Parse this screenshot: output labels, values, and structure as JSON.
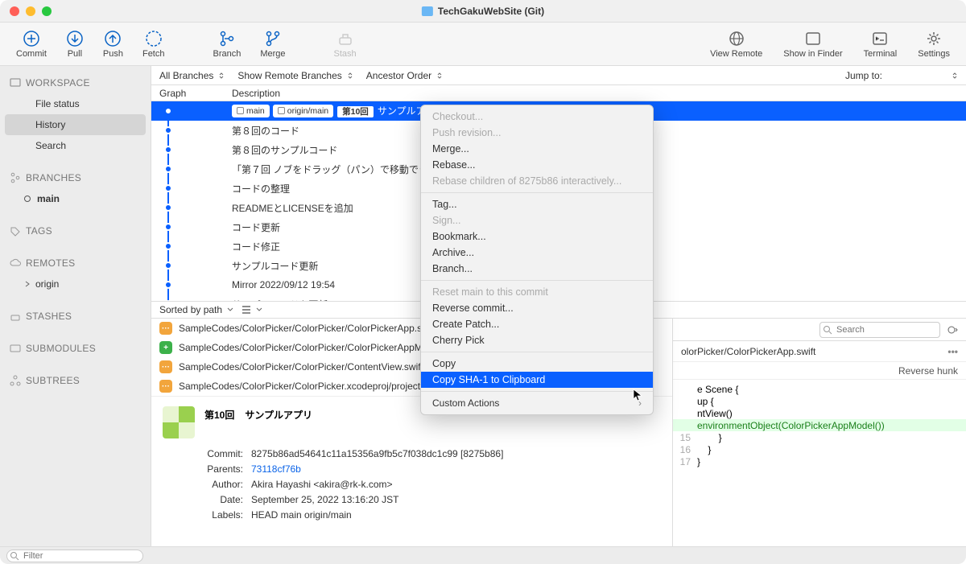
{
  "title": "TechGakuWebSite (Git)",
  "toolbar": {
    "commit": "Commit",
    "pull": "Pull",
    "push": "Push",
    "fetch": "Fetch",
    "branch": "Branch",
    "merge": "Merge",
    "stash": "Stash",
    "view_remote": "View Remote",
    "show_in_finder": "Show in Finder",
    "terminal": "Terminal",
    "settings": "Settings"
  },
  "sidebar": {
    "workspace_hdr": "WORKSPACE",
    "file_status": "File status",
    "history": "History",
    "search": "Search",
    "branches_hdr": "BRANCHES",
    "main_branch": "main",
    "tags_hdr": "TAGS",
    "remotes_hdr": "REMOTES",
    "origin": "origin",
    "stashes_hdr": "STASHES",
    "submodules_hdr": "SUBMODULES",
    "subtrees_hdr": "SUBTREES"
  },
  "filterbar": {
    "all_branches": "All Branches",
    "show_remote": "Show Remote Branches",
    "ancestor": "Ancestor Order",
    "jump": "Jump to:"
  },
  "cols": {
    "graph": "Graph",
    "desc": "Description"
  },
  "commits": [
    {
      "badges": [
        "main",
        "origin/main"
      ],
      "episode": "第10回",
      "text": "サンプルア"
    },
    {
      "text": "第８回のコード"
    },
    {
      "text": "第８回のサンプルコード"
    },
    {
      "text": "「第７回 ノブをドラッグ（パン）で移動できるよ"
    },
    {
      "text": "コードの整理"
    },
    {
      "text": "READMEとLICENSEを追加"
    },
    {
      "text": "コード更新"
    },
    {
      "text": "コード修正"
    },
    {
      "text": "サンプルコード更新"
    },
    {
      "text": "Mirror 2022/09/12 19:54"
    },
    {
      "text": "サンプルコードを更新"
    }
  ],
  "sortbar": {
    "sorted": "Sorted by path"
  },
  "files": [
    {
      "s": "m",
      "path": "SampleCodes/ColorPicker/ColorPicker/ColorPickerApp.swift"
    },
    {
      "s": "a",
      "path": "SampleCodes/ColorPicker/ColorPicker/ColorPickerAppMode"
    },
    {
      "s": "m",
      "path": "SampleCodes/ColorPicker/ColorPicker/ContentView.swift"
    },
    {
      "s": "m",
      "path": "SampleCodes/ColorPicker/ColorPicker.xcodeproj/project.pb"
    }
  ],
  "cinfo": {
    "title_ep": "第10回",
    "title_txt": "サンプルアプリ",
    "commit_k": "Commit:",
    "commit_v": "8275b86ad54641c11a15356a9fb5c7f038dc1c99 [8275b86]",
    "parents_k": "Parents:",
    "parents_v": "73118cf76b",
    "author_k": "Author:",
    "author_v": "Akira Hayashi <akira@rk-k.com>",
    "date_k": "Date:",
    "date_v": "September 25, 2022 13:16:20 JST",
    "labels_k": "Labels:",
    "labels_v": "HEAD main origin/main"
  },
  "right": {
    "search_ph": "Search",
    "file": "olorPicker/ColorPickerApp.swift",
    "reverse": "Reverse hunk",
    "code": [
      {
        "ln": "",
        "t": "e Scene {"
      },
      {
        "ln": "",
        "t": "up {"
      },
      {
        "ln": "",
        "t": "ntView()"
      },
      {
        "ln": "",
        "t": "environmentObject(ColorPickerAppModel())",
        "add": true
      },
      {
        "ln": "15",
        "t": "        }"
      },
      {
        "ln": "16",
        "t": "    }"
      },
      {
        "ln": "17",
        "t": "}"
      }
    ]
  },
  "menu": {
    "checkout": "Checkout...",
    "push_rev": "Push revision...",
    "merge": "Merge...",
    "rebase": "Rebase...",
    "rebase_children": "Rebase children of 8275b86 interactively...",
    "tag": "Tag...",
    "sign": "Sign...",
    "bookmark": "Bookmark...",
    "archive": "Archive...",
    "branch": "Branch...",
    "reset": "Reset main to this commit",
    "reverse": "Reverse commit...",
    "patch": "Create Patch...",
    "cherry": "Cherry Pick",
    "copy": "Copy",
    "copy_sha": "Copy SHA-1 to Clipboard",
    "custom": "Custom Actions"
  },
  "footer": {
    "filter_ph": "Filter"
  }
}
